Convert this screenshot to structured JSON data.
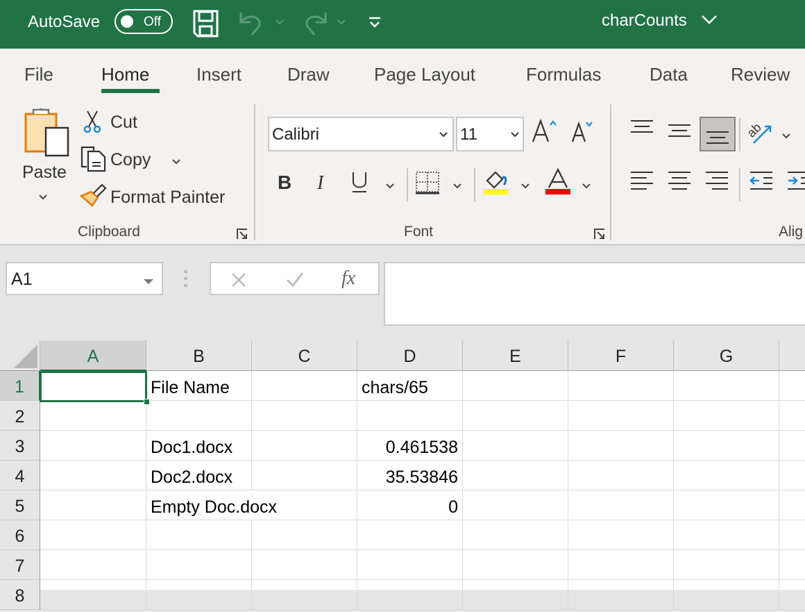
{
  "titlebar": {
    "autosave_label": "AutoSave",
    "autosave_state": "Off",
    "qat": [
      "save-icon",
      "undo-icon",
      "redo-icon",
      "customize-qat-icon"
    ],
    "document_title": "charCounts",
    "brand_color": "#217346"
  },
  "tabs": [
    {
      "label": "File"
    },
    {
      "label": "Home",
      "active": true
    },
    {
      "label": "Insert"
    },
    {
      "label": "Draw"
    },
    {
      "label": "Page Layout"
    },
    {
      "label": "Formulas"
    },
    {
      "label": "Data"
    },
    {
      "label": "Review"
    }
  ],
  "ribbon": {
    "clipboard": {
      "paste": "Paste",
      "cut": "Cut",
      "copy": "Copy",
      "format_painter": "Format Painter",
      "group_label": "Clipboard"
    },
    "font": {
      "font_name": "Calibri",
      "font_size": "11",
      "group_label": "Font",
      "highlight_color": "#ffff00",
      "font_color": "#ff0000"
    },
    "alignment": {
      "group_label": "Alig"
    }
  },
  "formula_bar": {
    "name_box": "A1",
    "fx_label": "fx",
    "formula": ""
  },
  "sheet": {
    "columns": [
      "A",
      "B",
      "C",
      "D",
      "E",
      "F",
      "G"
    ],
    "selected_cell": "A1",
    "rows": [
      {
        "num": "1",
        "B": "File Name",
        "D": "chars/65"
      },
      {
        "num": "2",
        "B": "",
        "D": ""
      },
      {
        "num": "3",
        "B": "Doc1.docx",
        "D": "0.461538"
      },
      {
        "num": "4",
        "B": "Doc2.docx",
        "D": "35.53846"
      },
      {
        "num": "5",
        "B": "Empty Doc.docx",
        "D": "0"
      },
      {
        "num": "6",
        "B": "",
        "D": ""
      },
      {
        "num": "7",
        "B": "",
        "D": ""
      },
      {
        "num": "8",
        "B": "",
        "D": ""
      }
    ]
  }
}
